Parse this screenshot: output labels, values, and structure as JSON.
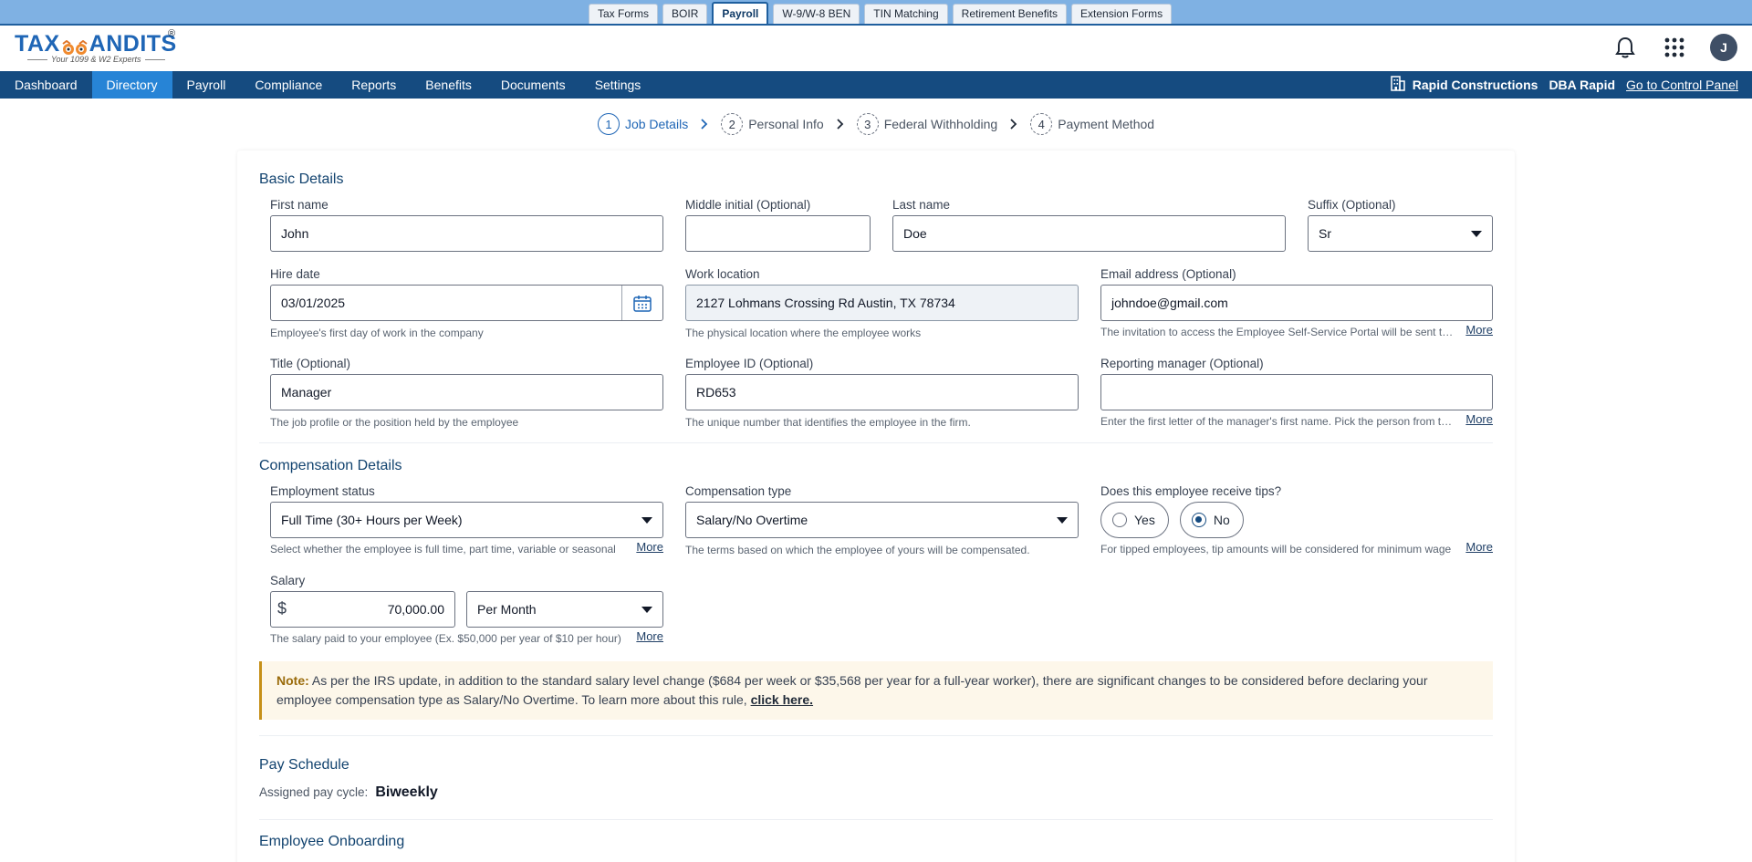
{
  "top_tabs": [
    "Tax Forms",
    "BOIR",
    "Payroll",
    "W-9/W-8 BEN",
    "TIN Matching",
    "Retirement Benefits",
    "Extension Forms"
  ],
  "logo": {
    "brand_left": "TAX",
    "brand_right": "ANDITS",
    "reg": "®",
    "tagline": "Your 1099 & W2 Experts"
  },
  "header": {
    "avatar_initial": "J"
  },
  "nav": {
    "items": [
      "Dashboard",
      "Directory",
      "Payroll",
      "Compliance",
      "Reports",
      "Benefits",
      "Documents",
      "Settings"
    ],
    "company": "Rapid Constructions",
    "dba": "DBA Rapid",
    "control_panel": "Go to Control Panel"
  },
  "stepper": [
    {
      "num": "1",
      "label": "Job Details"
    },
    {
      "num": "2",
      "label": "Personal Info"
    },
    {
      "num": "3",
      "label": "Federal Withholding"
    },
    {
      "num": "4",
      "label": "Payment Method"
    }
  ],
  "basic": {
    "title": "Basic Details",
    "first_name": {
      "label": "First name",
      "value": "John"
    },
    "middle_initial": {
      "label": "Middle initial (Optional)",
      "value": ""
    },
    "last_name": {
      "label": "Last name",
      "value": "Doe"
    },
    "suffix": {
      "label": "Suffix (Optional)",
      "value": "Sr"
    },
    "hire_date": {
      "label": "Hire date",
      "value": "03/01/2025",
      "help": "Employee's first day of work in the company"
    },
    "work_location": {
      "label": "Work location",
      "value": "2127 Lohmans Crossing Rd Austin, TX 78734",
      "help": "The physical location where the employee works"
    },
    "email": {
      "label": "Email address (Optional)",
      "value": "johndoe@gmail.com",
      "help": "The invitation to access the Employee Self-Service Portal will be sent to this email",
      "more": "More"
    },
    "title_field": {
      "label": "Title (Optional)",
      "value": "Manager",
      "help": "The job profile or the position held by the employee"
    },
    "employee_id": {
      "label": "Employee ID (Optional)",
      "value": "RD653",
      "help": "The unique number that identifies the employee in the firm."
    },
    "reporting_manager": {
      "label": "Reporting manager (Optional)",
      "value": "",
      "help": "Enter the first letter of the manager's first name. Pick the person from the list",
      "more": "More"
    }
  },
  "compensation": {
    "title": "Compensation Details",
    "employment_status": {
      "label": "Employment status",
      "value": "Full Time (30+ Hours per Week)",
      "help": "Select whether the employee is full time, part time, variable or seasonal",
      "more": "More"
    },
    "compensation_type": {
      "label": "Compensation type",
      "value": "Salary/No Overtime",
      "help": "The terms based on which the employee of yours will be compensated."
    },
    "tips": {
      "label": "Does this employee receive tips?",
      "yes": "Yes",
      "no": "No",
      "selected": "No",
      "help": "For tipped employees, tip amounts will be considered for minimum wage",
      "more": "More"
    },
    "salary": {
      "label": "Salary",
      "currency": "$",
      "value": "70,000.00",
      "period": "Per Month",
      "help": "The salary paid to your employee (Ex. $50,000 per year of $10 per hour)",
      "more": "More"
    }
  },
  "note": {
    "label": "Note:",
    "text": "As per the IRS update, in addition to the standard salary level change ($684 per week or $35,568 per year for a full-year worker), there are significant changes to be considered before declaring your employee compensation type as Salary/No Overtime. To learn more about this rule,",
    "link": "click here."
  },
  "pay_schedule": {
    "title": "Pay Schedule",
    "label": "Assigned pay cycle:",
    "value": "Biweekly"
  },
  "onboarding": {
    "title": "Employee Onboarding"
  },
  "colors": {
    "nav_bg": "#154b80",
    "nav_active": "#2784d6",
    "top_strip": "#7fb1e3",
    "note_bg": "#fdf7ea",
    "note_accent": "#c69019"
  }
}
